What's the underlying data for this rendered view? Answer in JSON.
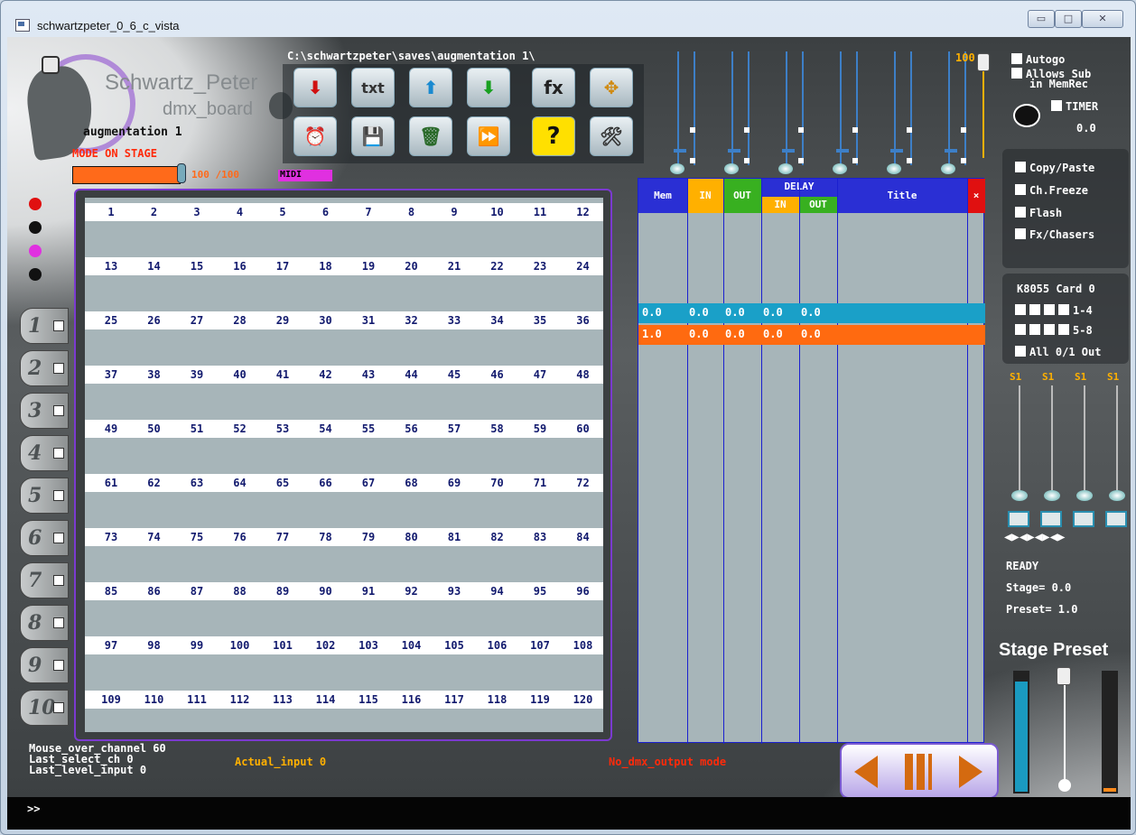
{
  "window": {
    "title": "schwartzpeter_0_6_c_vista",
    "min_label": "▭",
    "max_label": "□",
    "close_label": "✕"
  },
  "logo": {
    "title": "Schwartz_Peter",
    "subtitle": "dmx_board",
    "show_name": "augmentation 1"
  },
  "mode_label": "MODE ON STAGE",
  "grand_master": {
    "value_text": "100 /100",
    "level": 1.0
  },
  "midi_label": "MIDI",
  "path": "C:\\schwartzpeter\\saves\\augmentation 1\\",
  "toolbar": {
    "row1": [
      {
        "icon": "record-down-icon",
        "label": "⬇"
      },
      {
        "icon": "text-icon",
        "label": "txt"
      },
      {
        "icon": "up-icon",
        "label": "⬆"
      },
      {
        "icon": "green-down-icon",
        "label": "⬇"
      },
      {
        "icon": "fx-icon",
        "label": "fx"
      },
      {
        "icon": "move-icon",
        "label": "✥"
      }
    ],
    "row2": [
      {
        "icon": "alarm-clock-icon",
        "label": "⏰"
      },
      {
        "icon": "save-icon",
        "label": "💾"
      },
      {
        "icon": "trash-icon",
        "label": "🗑"
      },
      {
        "icon": "fast-forward-icon",
        "label": "⏩"
      },
      {
        "icon": "help-icon",
        "label": "?"
      },
      {
        "icon": "tools-icon",
        "label": "🛠"
      }
    ]
  },
  "top_fader_value": "100",
  "checkboxes_top": {
    "autogo": "Autogo",
    "allows_sub_1": "Allows Sub",
    "allows_sub_2": "in MemRec",
    "timer": "TIMER",
    "timer_value": "0.0"
  },
  "options": [
    "Copy/Paste",
    "Ch.Freeze",
    "Flash",
    "Fx/Chasers"
  ],
  "k8055": {
    "title": "K8055 Card 0",
    "row1": "1-4",
    "row2": "5-8",
    "all": "All 0/1 Out"
  },
  "mini_faders": [
    "S1",
    "S1",
    "S1",
    "S1"
  ],
  "status": {
    "ready": "READY",
    "stage": "Stage= 0.0",
    "preset": "Preset= 1.0"
  },
  "stage_preset_title": "Stage Preset",
  "channels": [
    "1",
    "2",
    "3",
    "4",
    "5",
    "6",
    "7",
    "8",
    "9",
    "10",
    "11",
    "12",
    "13",
    "14",
    "15",
    "16",
    "17",
    "18",
    "19",
    "20",
    "21",
    "22",
    "23",
    "24",
    "25",
    "26",
    "27",
    "28",
    "29",
    "30",
    "31",
    "32",
    "33",
    "34",
    "35",
    "36",
    "37",
    "38",
    "39",
    "40",
    "41",
    "42",
    "43",
    "44",
    "45",
    "46",
    "47",
    "48",
    "49",
    "50",
    "51",
    "52",
    "53",
    "54",
    "55",
    "56",
    "57",
    "58",
    "59",
    "60",
    "61",
    "62",
    "63",
    "64",
    "65",
    "66",
    "67",
    "68",
    "69",
    "70",
    "71",
    "72",
    "73",
    "74",
    "75",
    "76",
    "77",
    "78",
    "79",
    "80",
    "81",
    "82",
    "83",
    "84",
    "85",
    "86",
    "87",
    "88",
    "89",
    "90",
    "91",
    "92",
    "93",
    "94",
    "95",
    "96",
    "97",
    "98",
    "99",
    "100",
    "101",
    "102",
    "103",
    "104",
    "105",
    "106",
    "107",
    "108",
    "109",
    "110",
    "111",
    "112",
    "113",
    "114",
    "115",
    "116",
    "117",
    "118",
    "119",
    "120"
  ],
  "page_tabs": [
    "1",
    "2",
    "3",
    "4",
    "5",
    "6",
    "7",
    "8",
    "9",
    "10"
  ],
  "cue_table": {
    "headers": {
      "mem": "Mem",
      "in": "IN",
      "out": "OUT",
      "delay": "DELAY",
      "delay_in": "IN",
      "delay_out": "OUT",
      "title": "Title",
      "close": "×"
    },
    "rows": [
      {
        "mem": "0.0",
        "in": "0.0",
        "out": "0.0",
        "d_in": "0.0",
        "d_out": "0.0",
        "title": "",
        "color": "#1aa0c8"
      },
      {
        "mem": "1.0",
        "in": "0.0",
        "out": "0.0",
        "d_in": "0.0",
        "d_out": "0.0",
        "title": "",
        "color": "#ff6a10"
      }
    ]
  },
  "bottom": {
    "mouse_over": "Mouse_over_channel 60",
    "last_select": "Last_select_ch 0",
    "last_level": "Last_level_input 0",
    "actual_input": "Actual_input 0",
    "no_dmx": "No_dmx_output mode"
  },
  "command_prompt": ">>",
  "colors": {
    "accent_orange": "#ff6a1a",
    "cue_blue": "#1aa0c8",
    "grid_bg": "#a7b5b9",
    "border_purple": "#7b3ad0"
  }
}
